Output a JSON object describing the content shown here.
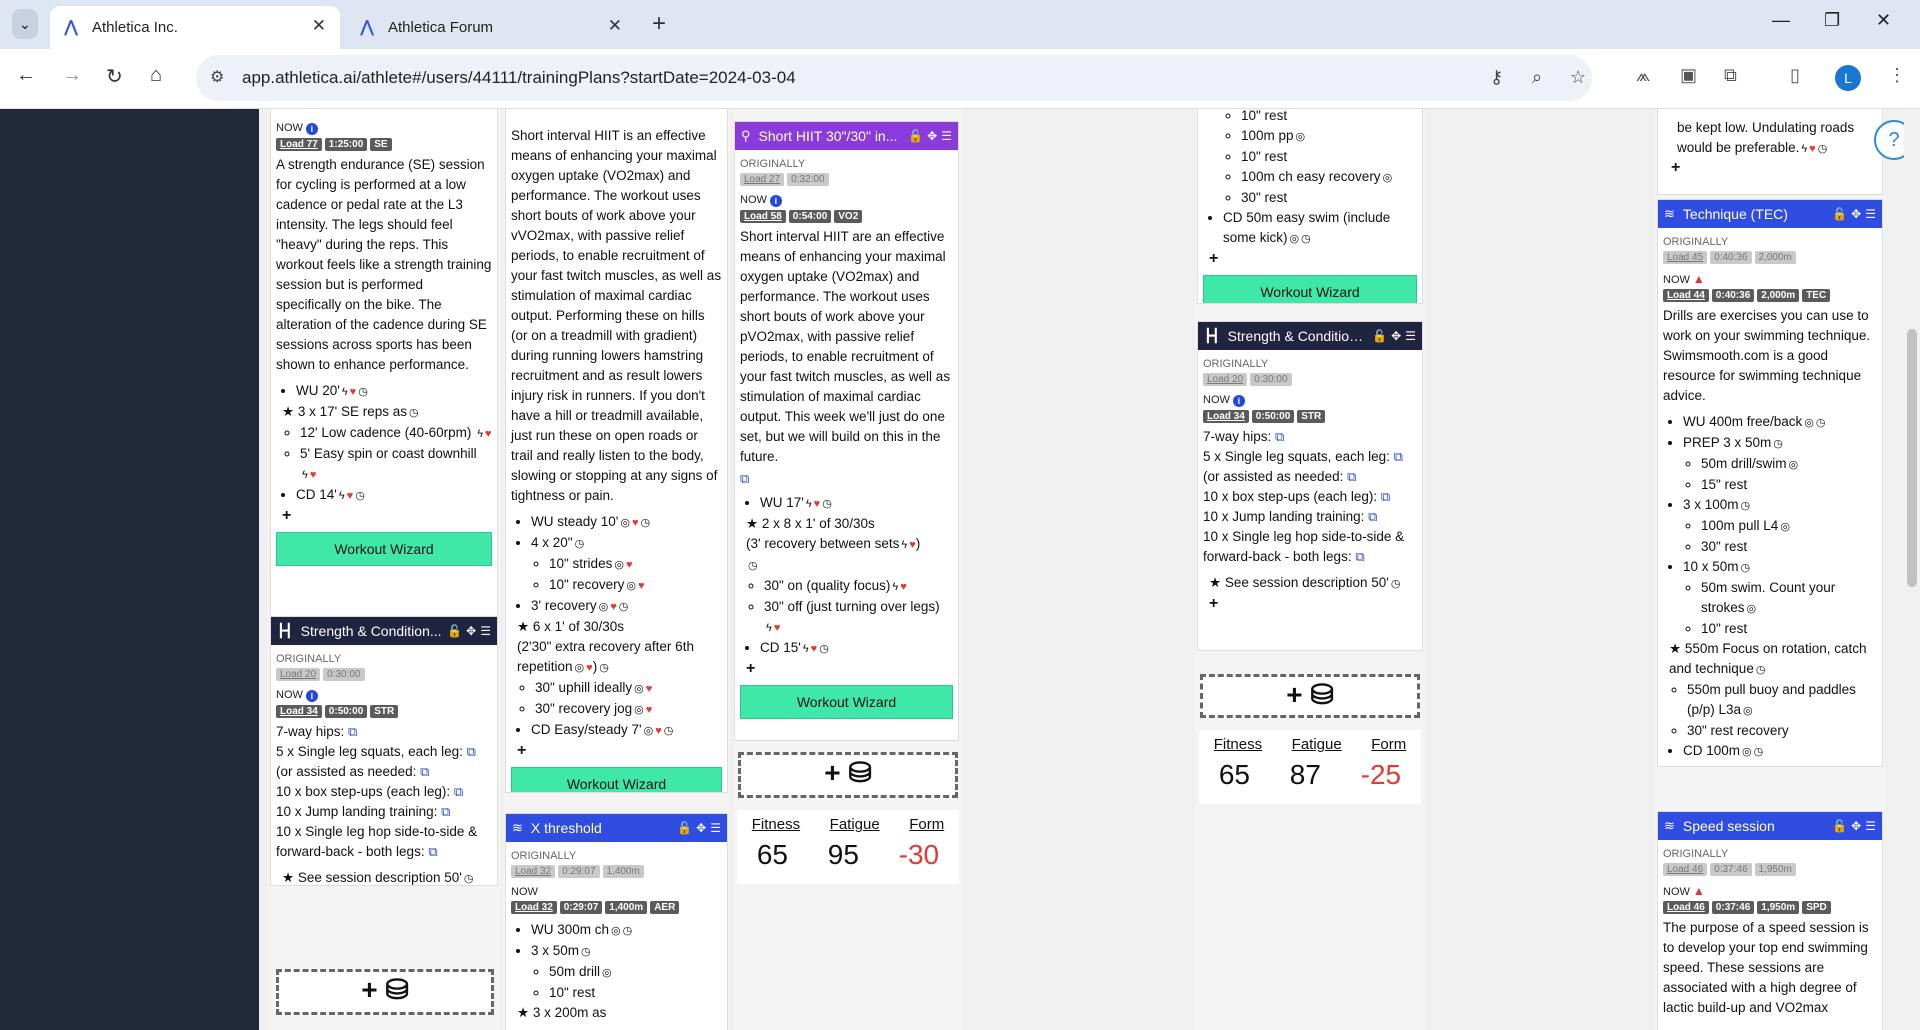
{
  "browser": {
    "tabs": [
      {
        "title": "Athletica Inc.",
        "active": true
      },
      {
        "title": "Athletica Forum",
        "active": false
      }
    ],
    "url": "app.athletica.ai/athlete#/users/44111/trainingPlans?startDate=2024-03-04",
    "avatar_letter": "L"
  },
  "icons": {
    "bolt": "ϟ",
    "heart": "♥",
    "clock": "◷",
    "swim": "◎",
    "ext": "⧉",
    "star": "★",
    "lock": "🔓",
    "move": "✥",
    "menu": "☰",
    "plus": "+",
    "db": "⛁",
    "dumbbell": "┣┫",
    "swimmer": "≋",
    "bike": "⚲"
  },
  "labels": {
    "originally": "ORIGINALLY",
    "now": "NOW",
    "wizard": "Workout Wizard",
    "fitness": "Fitness",
    "fatigue": "Fatigue",
    "form": "Form"
  },
  "col1": {
    "se": {
      "now_badges": [
        "Load 77",
        "1:25:00",
        "SE"
      ],
      "desc": "A strength endurance (SE) session for cycling is performed at a low cadence or pedal rate at the L3 intensity. The legs should feel \"heavy\" during the reps. This workout feels like a strength training session but is performed specifically on the bike. The alteration of the cadence during SE sessions across sports has been shown to enhance performance.",
      "steps": [
        "WU 20'",
        "3 x 17' SE reps as",
        "12' Low cadence (40-60rpm)",
        "5' Easy spin or coast downhill",
        "CD 14'"
      ]
    },
    "str": {
      "title": "Strength & Condition...",
      "orig_badges": [
        "Load 20",
        "0:30:00"
      ],
      "now_badges": [
        "Load 34",
        "0:50:00",
        "STR"
      ],
      "lines": [
        "7-way hips:",
        "5 x Single leg squats, each leg:",
        "(or assisted as needed:",
        "10 x box step-ups (each leg):",
        "10 x Jump landing training:",
        "10 x Single leg hop side-to-side & forward-back - both legs:"
      ],
      "step": "See session description 50'"
    }
  },
  "col2": {
    "hiit": {
      "desc": "Short interval HIIT is an effective means of enhancing your maximal oxygen uptake (VO2max) and performance. The workout uses short bouts of work above your vVO2max, with passive relief periods, to enable recruitment of your fast twitch muscles, as well as stimulation of maximal cardiac output. Performing these on hills (or on a treadmill with gradient) during running lowers hamstring recruitment and as result lowers injury risk in runners. If you don't have a hill or treadmill available, just run these on open roads or trail and really listen to the body, slowing or stopping at any signs of tightness or pain.",
      "steps": [
        "WU steady 10'",
        "4 x 20\"",
        "10\" strides",
        "10\" recovery",
        "3' recovery",
        "6 x 1' of 30/30s",
        "(2'30\" extra recovery after 6th repetition",
        "30\" uphill ideally",
        "30\" recovery jog",
        "CD Easy/steady 7'"
      ]
    },
    "xt": {
      "title": "X threshold",
      "orig_badges": [
        "Load 32",
        "0:29:07",
        "1,400m"
      ],
      "now_badges": [
        "Load 32",
        "0:29:07",
        "1,400m",
        "AER"
      ],
      "steps": [
        "WU 300m ch",
        "3 x 50m",
        "50m drill",
        "10\" rest",
        "3 x 200m as"
      ]
    }
  },
  "col3": {
    "hiit": {
      "title": "Short HIIT 30\"/30\" in...",
      "orig_badges": [
        "Load 27",
        "0:32:00"
      ],
      "now_badges": [
        "Load 58",
        "0:54:00",
        "VO2"
      ],
      "desc": "Short interval HIIT are an effective means of enhancing your maximal oxygen uptake (VO2max) and performance. The workout uses short bouts of work above your pVO2max, with passive relief periods, to enable recruitment of your fast twitch muscles, as well as stimulation of maximal cardiac output. This week we'll just do one set, but we will build on this in the future.",
      "steps": [
        "WU 17'",
        "2 x 8 x 1' of 30/30s",
        "(3' recovery between sets",
        "30\" on (quality focus)",
        "30\" off (just turning over legs)",
        "CD 15'"
      ]
    },
    "metrics": {
      "fitness": "65",
      "fatigue": "95",
      "form": "-30"
    }
  },
  "col4": {
    "swim": {
      "steps": [
        "10\" rest",
        "100m pp",
        "10\" rest",
        "100m ch easy recovery",
        "30\" rest",
        "CD 50m easy swim (include some kick)"
      ]
    },
    "str": {
      "title": "Strength & Condition...",
      "orig_badges": [
        "Load 20",
        "0:30:00"
      ],
      "now_badges": [
        "Load 34",
        "0:50:00",
        "STR"
      ],
      "lines": [
        "7-way hips:",
        "5 x Single leg squats, each leg:",
        "(or assisted as needed:",
        "10 x box step-ups (each leg):",
        "10 x Jump landing training:",
        "10 x Single leg hop side-to-side & forward-back - both legs:"
      ],
      "step": "See session description 50'"
    },
    "metrics": {
      "fitness": "65",
      "fatigue": "87",
      "form": "-25"
    }
  },
  "col5": {
    "top": {
      "steps": [
        "be kept low. Undulating roads would be preferable."
      ]
    },
    "tec": {
      "title": "Technique (TEC)",
      "orig_badges": [
        "Load 45",
        "0:40:36",
        "2,000m"
      ],
      "now_badges": [
        "Load 44",
        "0:40:36",
        "2,000m",
        "TEC"
      ],
      "desc": "Drills are exercises you can use to work on your swimming technique. Swimsmooth.com is a good resource for swimming technique advice.",
      "steps": [
        "WU 400m free/back",
        "PREP 3 x 50m",
        "50m drill/swim",
        "15\" rest",
        "3 x 100m",
        "100m pull L4",
        "30\" rest",
        "10 x 50m",
        "50m swim. Count your strokes",
        "10\" rest",
        "550m Focus on rotation, catch and technique",
        "550m pull buoy and paddles (p/p) L3a",
        "30\" rest recovery",
        "CD 100m"
      ]
    },
    "spd": {
      "title": "Speed session",
      "orig_badges": [
        "Load 46",
        "0:37:46",
        "1,950m"
      ],
      "now_badges": [
        "Load 46",
        "0:37:46",
        "1,950m",
        "SPD"
      ],
      "desc": "The purpose of a speed session is to develop your top end swimming speed. These sessions are associated with a high degree of lactic build-up and VO2max"
    }
  }
}
